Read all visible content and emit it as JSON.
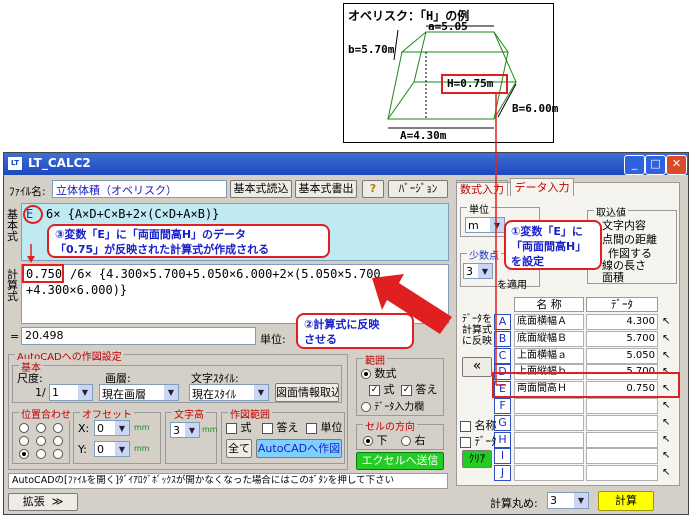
{
  "diagram": {
    "title": "オベリスク：「H」の例",
    "label_a": "a=5.05",
    "label_b": "b=5.70m",
    "label_H": "H=0.75m",
    "label_B": "B=6.00m",
    "label_A": "A=4.30m"
  },
  "window": {
    "icon": "LT",
    "title": "LT_CALC2",
    "min": "_",
    "max": "□",
    "close": "✕"
  },
  "file": {
    "label": "ﾌｧｲﾙ名:",
    "name": "立体体積（オベリスク）",
    "btn_load": "基本式読込",
    "btn_write": "基本式書出",
    "help": "?",
    "btn_version": "ﾊﾞｰｼﾞｮﾝ"
  },
  "formula": {
    "side_label": "基本式",
    "var": "E",
    "text": "6× {A×D+C×B+2×(C×D+A×B)}"
  },
  "calc": {
    "side_label": "計算式",
    "highlight": "0.750",
    "line1": "/6× {4.300×5.700+5.050×6.000+2×(5.050×5.700",
    "line2": "+4.300×6.000)}"
  },
  "result": {
    "eq": "=",
    "value": "20.498",
    "unit_label": "単位:"
  },
  "callouts": {
    "c1_line1": "①変数「E」に",
    "c1_line2": "「両面間高H」",
    "c1_line3": "を設定",
    "c2_line1": "②計算式に反映",
    "c2_line2": "させる",
    "c3_line1": "③変数「E」に「両面間高H」のデータ",
    "c3_line2": "「0.75」が反映された計算式が作成される"
  },
  "autocad": {
    "group": "AutoCADへの作図設定",
    "basic": "基本",
    "scale_label": "尺度:",
    "scale_prefix": "1/",
    "scale_value": "1",
    "layer_label": "画層:",
    "layer_value": "現在画層",
    "style_label": "文字ｽﾀｲﾙ:",
    "style_value": "現在ｽﾀｲﾙ",
    "btn_draw_info": "図面情報取込",
    "pos_label": "位置合わせ",
    "offset_label": "オフセット",
    "x_label": "X:",
    "x_value": "0",
    "y_label": "Y:",
    "y_value": "0",
    "mm": "mm",
    "height_label": "文字高",
    "height_value": "3",
    "range_label": "作図範囲",
    "chk_formula": "式",
    "chk_answer": "答え",
    "chk_unit": "単位",
    "btn_all": "全て",
    "btn_draw": "AutoCADへ作図"
  },
  "range": {
    "label": "範囲",
    "opt_formula": "数式",
    "chk_formula": "式",
    "chk_answer": "答え",
    "opt_data": "ﾃﾞｰﾀ入力欄"
  },
  "direction": {
    "label": "セルの方向",
    "down": "下",
    "right": "右"
  },
  "btn_excel": "エクセルへ送信",
  "status": "AutoCADの[ﾌｧｲﾙを開く]ﾀﾞｲｱﾛｸﾞﾎﾞｯｸｽが開かなくなった場合にはこのﾎﾞﾀﾝを押して下さい",
  "btn_expand": "拡張",
  "btn_expand_arrow": "≫",
  "right": {
    "tab_formula": "数式入力",
    "tab_data": "データ入力",
    "unit_label": "単位",
    "unit_value": "m",
    "decimal_label": "少数点",
    "decimal_value": "3",
    "apply": "を適用",
    "capture_label": "取込値",
    "capture_opt1": "文字内容",
    "capture_opt2": "点間の距離",
    "capture_opt3": "作図する",
    "capture_opt4": "線の長さ",
    "capture_opt5": "面積",
    "reflect_label": "ﾃﾞｰﾀを計算式に反映",
    "arrow_left": "«",
    "col_name": "名 称",
    "col_data": "ﾃﾞｰﾀ",
    "rows": [
      {
        "key": "A",
        "name": "底面横幅Ａ",
        "value": "4.300"
      },
      {
        "key": "B",
        "name": "底面縦幅Ｂ",
        "value": "5.700"
      },
      {
        "key": "C",
        "name": "上面横幅ａ",
        "value": "5.050"
      },
      {
        "key": "D",
        "name": "上面縦幅ｂ",
        "value": "5.700"
      },
      {
        "key": "E",
        "name": "両面間高Ｈ",
        "value": "0.750"
      },
      {
        "key": "F",
        "name": "",
        "value": ""
      },
      {
        "key": "G",
        "name": "",
        "value": ""
      },
      {
        "key": "H",
        "name": "",
        "value": ""
      },
      {
        "key": "I",
        "name": "",
        "value": ""
      },
      {
        "key": "J",
        "name": "",
        "value": ""
      }
    ],
    "chk_name": "名称",
    "chk_data": "ﾃﾞｰﾀ",
    "btn_clear": "ｸﾘｱ",
    "round_label": "計算丸め:",
    "round_value": "3",
    "btn_calc": "計算"
  },
  "colors": {
    "accent_red": "#e02020",
    "callout_text": "#1a20c8",
    "formula_bg": "#bfeaf2",
    "calc_button": "#ffff00",
    "excel_button": "#22cc22"
  }
}
